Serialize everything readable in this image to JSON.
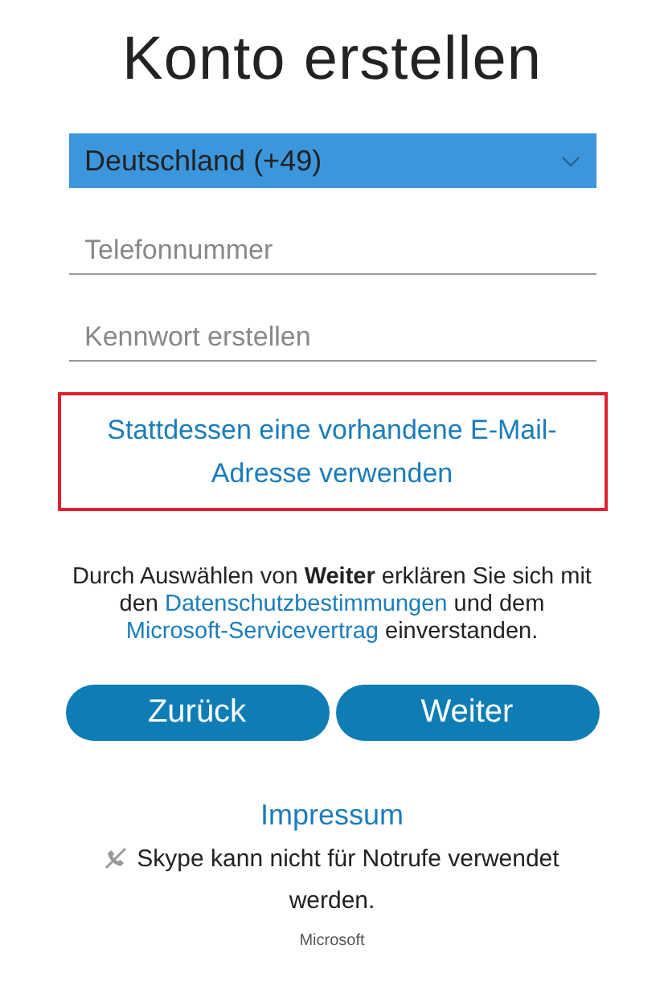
{
  "title": "Konto erstellen",
  "country_select": {
    "value": "Deutschland (+49)"
  },
  "fields": [
    {
      "placeholder": "Telefonnummer"
    },
    {
      "placeholder": "Kennwort erstellen"
    }
  ],
  "alt_link": {
    "text": "Stattdessen eine vorhandene E-Mail-Adresse verwenden",
    "focused": true
  },
  "consent": [
    {
      "kind": "text",
      "text": "Durch Auswählen von "
    },
    {
      "kind": "bold",
      "text": "Weiter"
    },
    {
      "kind": "text",
      "text": " erklären Sie sich mit den "
    },
    {
      "kind": "link",
      "text": "Datenschutzbestimmungen"
    },
    {
      "kind": "text",
      "text": " und dem "
    },
    {
      "kind": "link",
      "text": "Microsoft-Servicevertrag"
    },
    {
      "kind": "text",
      "text": " einverstanden."
    }
  ],
  "buttons": [
    {
      "label": "Zurück"
    },
    {
      "label": "Weiter"
    }
  ],
  "imprint_link": "Impressum",
  "emergency_note": "Skype kann nicht für Notrufe verwendet werden.",
  "footer": "Microsoft"
}
